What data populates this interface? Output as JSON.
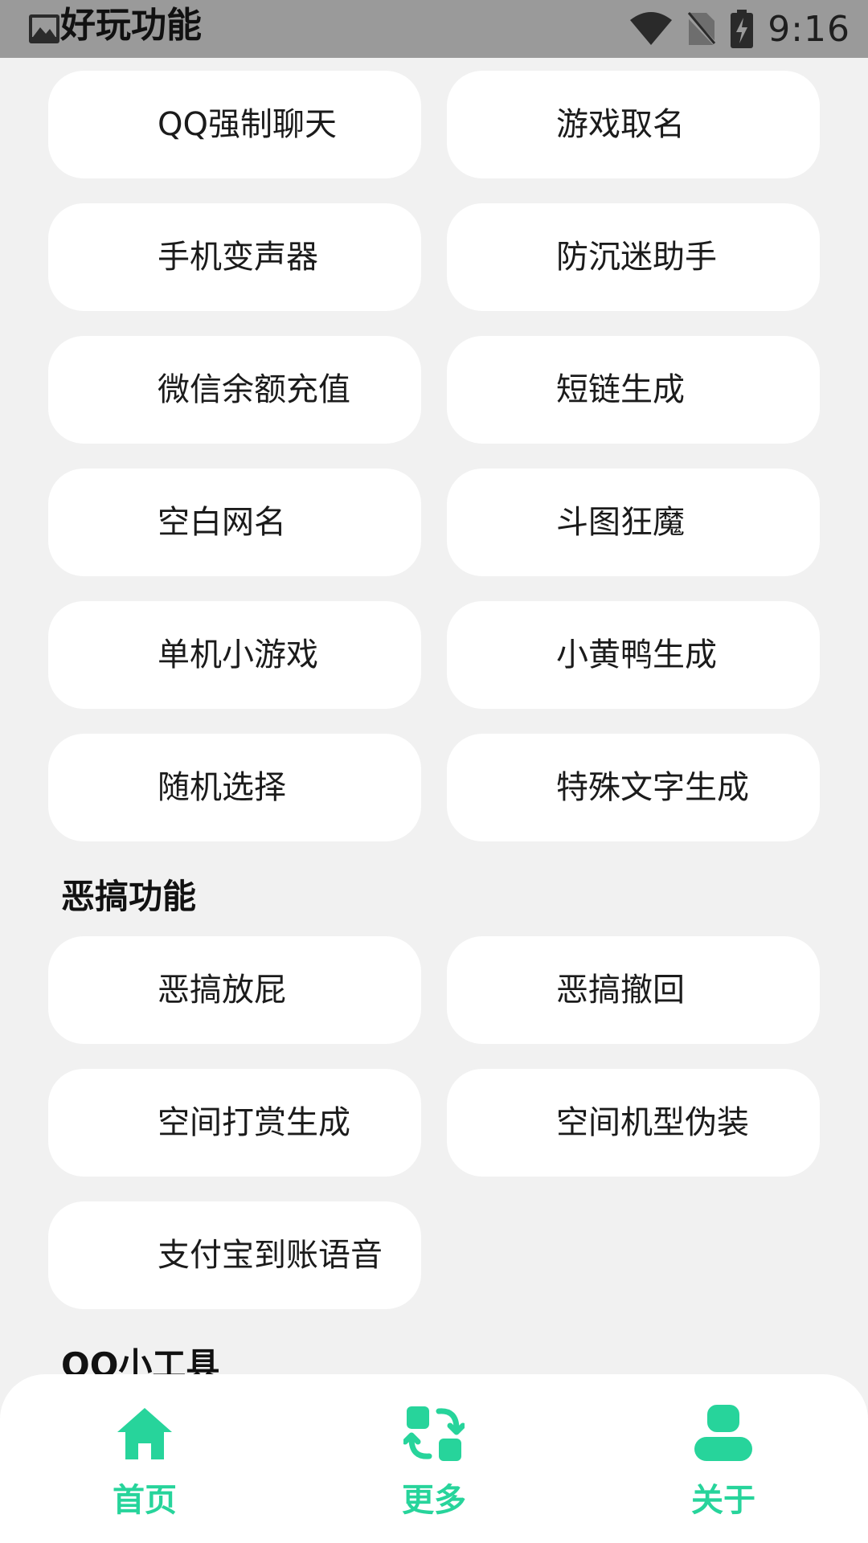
{
  "status_bar": {
    "title": "好玩功能",
    "time": "9:16"
  },
  "sections": [
    {
      "title": "",
      "items": [
        "QQ强制聊天",
        "游戏取名",
        "手机变声器",
        "防沉迷助手",
        "微信余额充值",
        "短链生成",
        "空白网名",
        "斗图狂魔",
        "单机小游戏",
        "小黄鸭生成",
        "随机选择",
        "特殊文字生成"
      ]
    },
    {
      "title": "恶搞功能",
      "items": [
        "恶搞放屁",
        "恶搞撤回",
        "空间打赏生成",
        "空间机型伪装",
        "支付宝到账语音"
      ]
    },
    {
      "title": "QQ小工具",
      "items": []
    }
  ],
  "bottom_nav": {
    "items": [
      {
        "label": "首页",
        "icon": "home-icon"
      },
      {
        "label": "更多",
        "icon": "more-icon"
      },
      {
        "label": "关于",
        "icon": "user-icon"
      }
    ],
    "accent": "#27d49b"
  }
}
